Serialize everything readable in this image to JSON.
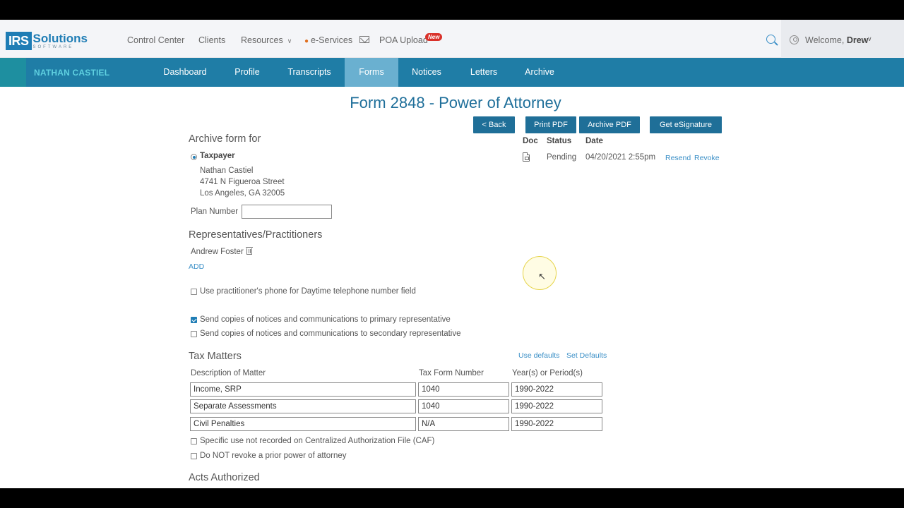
{
  "logo": {
    "box": "IRS",
    "word": "Solutions",
    "sub": "SOFTWARE"
  },
  "topnav": {
    "control_center": "Control Center",
    "clients": "Clients",
    "resources": "Resources",
    "eservices": "e-Services",
    "poa_upload": "POA Upload",
    "new_badge": "New",
    "welcome_prefix": "Welcome,",
    "user_name": "Drew"
  },
  "subnav": {
    "client_name": "NATHAN CASTIEL",
    "tabs": [
      "Dashboard",
      "Profile",
      "Transcripts",
      "Forms",
      "Notices",
      "Letters",
      "Archive"
    ],
    "active_tab": "Forms"
  },
  "page": {
    "title": "Form 2848 - Power of Attorney",
    "buttons": {
      "back": "< Back",
      "print_pdf": "Print PDF",
      "archive_pdf": "Archive PDF",
      "get_esignature": "Get eSignature"
    }
  },
  "archive_table": {
    "headers": {
      "doc": "Doc",
      "status": "Status",
      "date": "Date"
    },
    "row": {
      "status": "Pending",
      "date": "04/20/2021 2:55pm",
      "resend": "Resend",
      "revoke": "Revoke"
    }
  },
  "archive_form": {
    "heading": "Archive form for",
    "option": "Taxpayer",
    "name": "Nathan Castiel",
    "street": "4741 N Figueroa Street",
    "city": "Los Angeles, GA 32005",
    "plan_number_label": "Plan Number",
    "plan_number_value": ""
  },
  "representatives": {
    "heading": "Representatives/Practitioners",
    "items": [
      "Andrew Foster"
    ],
    "add_label": "ADD"
  },
  "checkboxes": {
    "practitioner_phone": {
      "label": "Use practitioner's phone for Daytime telephone number field",
      "checked": false
    },
    "copies_primary": {
      "label": "Send copies of notices and communications to primary representative",
      "checked": true
    },
    "copies_secondary": {
      "label": "Send copies of notices and communications to secondary representative",
      "checked": false
    },
    "specific_use": {
      "label": "Specific use not recorded on Centralized Authorization File (CAF)",
      "checked": false
    },
    "do_not_revoke": {
      "label": "Do NOT revoke a prior power of attorney",
      "checked": false
    }
  },
  "tax_matters": {
    "heading": "Tax Matters",
    "use_defaults": "Use defaults",
    "set_defaults": "Set Defaults",
    "columns": {
      "description": "Description of Matter",
      "form_number": "Tax Form Number",
      "years": "Year(s) or Period(s)"
    },
    "rows": [
      {
        "description": "Income, SRP",
        "form_number": "1040",
        "years": "1990-2022"
      },
      {
        "description": "Separate Assessments",
        "form_number": "1040",
        "years": "1990-2022"
      },
      {
        "description": "Civil Penalties",
        "form_number": "N/A",
        "years": "1990-2022"
      }
    ]
  },
  "acts_authorized": {
    "heading": "Acts Authorized"
  },
  "colors": {
    "brand": "#1f7db5",
    "subnav": "#1f7da6",
    "active_tab": "#6ab0d0",
    "button": "#1f6f98",
    "new_badge": "#d9312a"
  }
}
